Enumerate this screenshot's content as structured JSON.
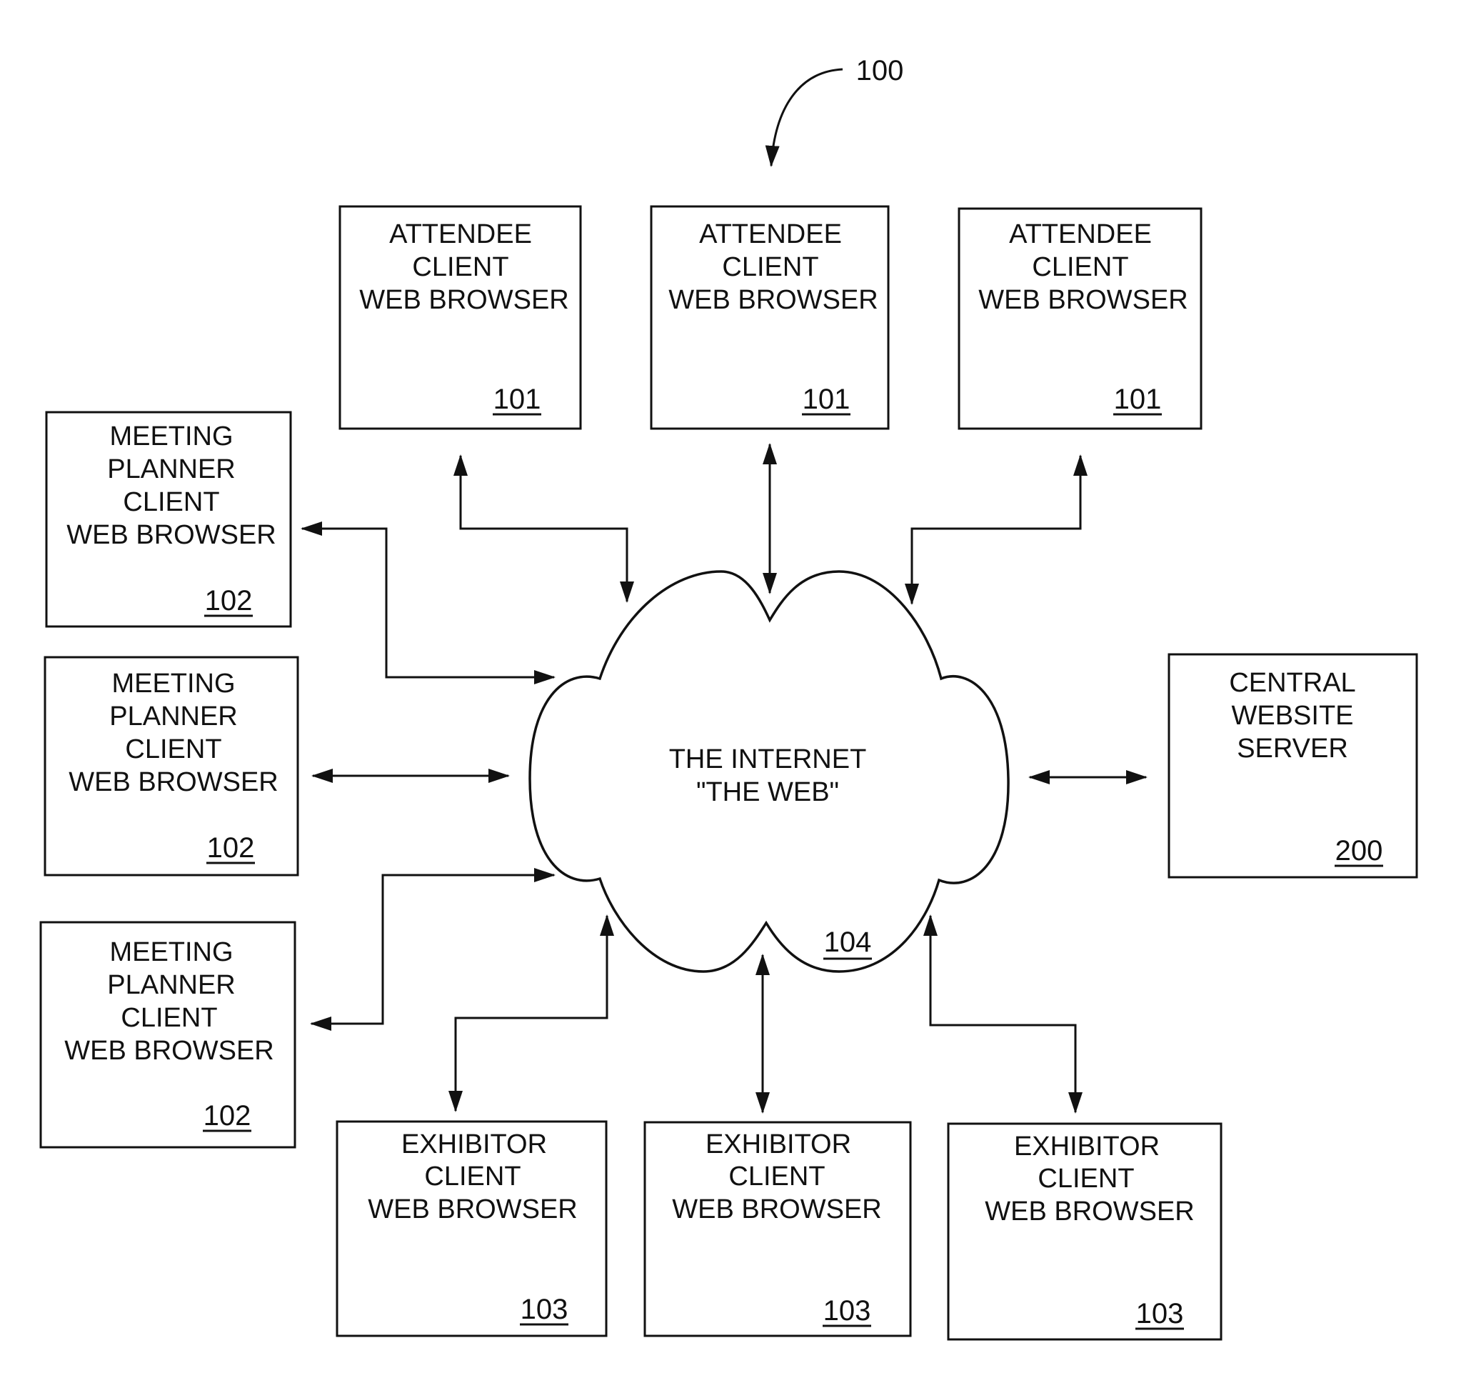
{
  "figure": {
    "reference": "100",
    "colors": {
      "ink": "#111111",
      "background": "#ffffff"
    }
  },
  "network": {
    "lines": [
      "THE INTERNET",
      "\"THE WEB\""
    ],
    "ref": "104"
  },
  "server": {
    "lines": [
      "CENTRAL",
      "WEBSITE",
      "SERVER"
    ],
    "ref": "200"
  },
  "attendees": [
    {
      "lines": [
        "ATTENDEE",
        "CLIENT",
        "WEB BROWSER"
      ],
      "ref": "101"
    },
    {
      "lines": [
        "ATTENDEE",
        "CLIENT",
        "WEB BROWSER"
      ],
      "ref": "101"
    },
    {
      "lines": [
        "ATTENDEE",
        "CLIENT",
        "WEB BROWSER"
      ],
      "ref": "101"
    }
  ],
  "planners": [
    {
      "lines": [
        "MEETING",
        "PLANNER",
        "CLIENT",
        "WEB BROWSER"
      ],
      "ref": "102"
    },
    {
      "lines": [
        "MEETING",
        "PLANNER",
        "CLIENT",
        "WEB BROWSER"
      ],
      "ref": "102"
    },
    {
      "lines": [
        "MEETING",
        "PLANNER",
        "CLIENT",
        "WEB BROWSER"
      ],
      "ref": "102"
    }
  ],
  "exhibitors": [
    {
      "lines": [
        "EXHIBITOR",
        "CLIENT",
        "WEB BROWSER"
      ],
      "ref": "103"
    },
    {
      "lines": [
        "EXHIBITOR",
        "CLIENT",
        "WEB BROWSER"
      ],
      "ref": "103"
    },
    {
      "lines": [
        "EXHIBITOR",
        "CLIENT",
        "WEB BROWSER"
      ],
      "ref": "103"
    }
  ]
}
